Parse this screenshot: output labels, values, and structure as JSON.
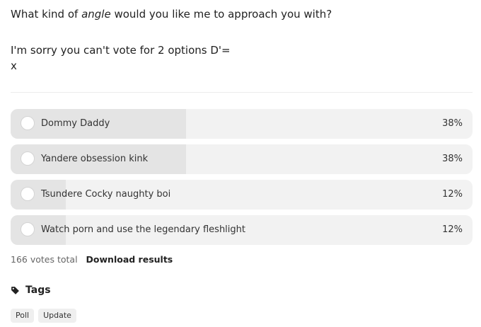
{
  "post": {
    "question_prefix": "What kind of ",
    "question_emphasis": "angle",
    "question_suffix": " would you like me to approach you with?",
    "apology": "I'm sorry you can't vote for 2 options D'=",
    "closing": "x"
  },
  "poll": {
    "options": [
      {
        "label": "Dommy Daddy",
        "percent_text": "38%",
        "share": 0.38
      },
      {
        "label": "Yandere obsession kink",
        "percent_text": "38%",
        "share": 0.38
      },
      {
        "label": "Tsundere Cocky naughty boi",
        "percent_text": "12%",
        "share": 0.12
      },
      {
        "label": "Watch porn and use the legendary fleshlight",
        "percent_text": "12%",
        "share": 0.12
      }
    ],
    "votes_total": "166 votes total",
    "download_label": "Download results"
  },
  "tags": {
    "heading": "Tags",
    "icon": "tag-icon",
    "items": [
      "Poll",
      "Update"
    ]
  },
  "colors": {
    "option_background": "#f2f2f2",
    "option_fill": "#e4e4e4",
    "text": "#222222"
  }
}
